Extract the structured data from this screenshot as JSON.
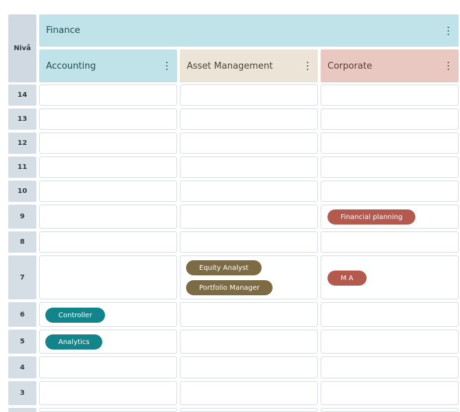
{
  "level_header": "Nivå",
  "family": {
    "label": "Finance"
  },
  "subfamilies": [
    {
      "label": "Accounting",
      "color": "#bfe3e8"
    },
    {
      "label": "Asset Management",
      "color": "#ece4d6"
    },
    {
      "label": "Corporate",
      "color": "#eac8c2"
    }
  ],
  "levels": [
    "14",
    "13",
    "12",
    "11",
    "10",
    "9",
    "8",
    "7",
    "6",
    "5",
    "4",
    "3"
  ],
  "roles": {
    "financial_planning": "Financial planning",
    "equity_analyst": "Equity Analyst",
    "portfolio_manager": "Portfolio Manager",
    "m_a": "M A",
    "controller": "Controller",
    "analytics": "Analytics"
  },
  "colors": {
    "teal": "#14848b",
    "olive": "#7d6b45",
    "red": "#b4594e"
  }
}
